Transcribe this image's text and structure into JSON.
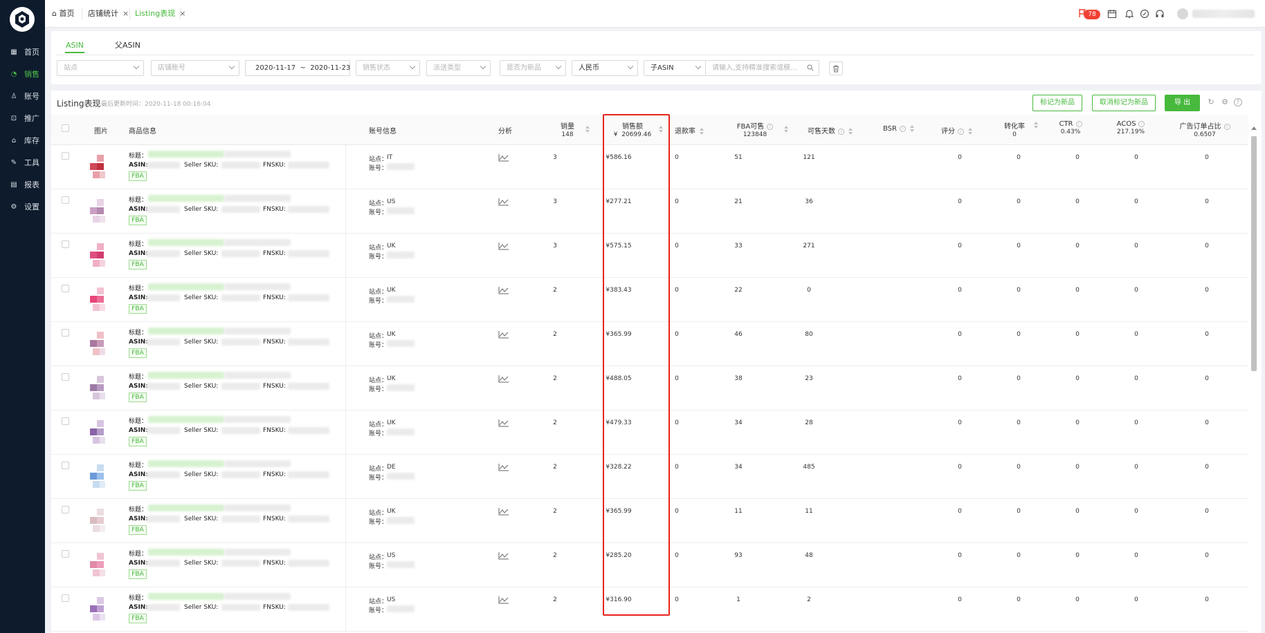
{
  "sidebar": {
    "items": [
      {
        "label": "首页",
        "icon": "grid-icon"
      },
      {
        "label": "销售",
        "icon": "chart-icon",
        "active": true
      },
      {
        "label": "账号",
        "icon": "user-icon"
      },
      {
        "label": "推广",
        "icon": "promotion-icon"
      },
      {
        "label": "库存",
        "icon": "warehouse-icon"
      },
      {
        "label": "工具",
        "icon": "tool-icon"
      },
      {
        "label": "报表",
        "icon": "table-icon"
      },
      {
        "label": "设置",
        "icon": "gear-icon"
      }
    ]
  },
  "topbar": {
    "tabs": [
      {
        "label": "首页"
      },
      {
        "label": "店铺统计"
      },
      {
        "label": "Listing表现",
        "active": true
      }
    ],
    "notification_count": "78"
  },
  "filters": {
    "subtabs": [
      "ASIN",
      "父ASIN"
    ],
    "site_placeholder": "站点",
    "account_placeholder": "店铺账号",
    "date_range": "2020-11-17  ~  2020-11-23",
    "sales_status_placeholder": "销售状态",
    "shipping_type_placeholder": "派送类型",
    "is_new_placeholder": "是否为新品",
    "currency": "人民币",
    "asin_type": "子ASIN",
    "search_placeholder": "请输入,支持精准搜索或模..."
  },
  "card": {
    "title": "Listing表现",
    "last_update": "最后更新时间：2020-11-18 00:16:04",
    "mark_new": "标记为新品",
    "unmark_new": "取消标记为新品",
    "export": "导 出"
  },
  "table": {
    "headers": {
      "image": "图片",
      "product": "商品信息",
      "account": "账号信息",
      "analysis": "分析",
      "sales_qty": "销量",
      "sales_qty_total": "148",
      "sales_amount": "销售额",
      "sales_amount_total": "¥  20699.46",
      "return_rate": "退款率",
      "fba_available": "FBA可售",
      "fba_available_total": "123848",
      "days_available": "可售天数",
      "bsr": "BSR",
      "rating": "评分",
      "conversion": "转化率",
      "conversion_total": "0",
      "ctr": "CTR",
      "ctr_total": "0.43%",
      "acos": "ACOS",
      "acos_total": "217.19%",
      "ad_order_ratio": "广告订单占比",
      "ad_order_ratio_total": "0.6507"
    },
    "labels": {
      "title": "标题：",
      "asin": "ASIN:",
      "seller_sku": "Seller SKU:",
      "fnsku": "FNSKU:",
      "fba": "FBA",
      "site": "站点：",
      "account": "账号："
    },
    "rows": [
      {
        "site": "IT",
        "qty": "3",
        "amount": "¥586.16",
        "refund": "0",
        "fba": "51",
        "days": "121",
        "rating": "0",
        "conv": "0",
        "ctr": "0",
        "acos": "0",
        "ad": "0",
        "swatch": [
          "#e8a0a8",
          "#d0485a",
          "#c0303f",
          "#f0c8cc"
        ]
      },
      {
        "site": "US",
        "qty": "3",
        "amount": "¥277.21",
        "refund": "0",
        "fba": "21",
        "days": "36",
        "rating": "0",
        "conv": "0",
        "ctr": "0",
        "acos": "0",
        "ad": "0",
        "swatch": [
          "#e9d3e6",
          "#c9a0c4",
          "#b58ab0",
          "#efe2ec"
        ]
      },
      {
        "site": "UK",
        "qty": "3",
        "amount": "¥575.15",
        "refund": "0",
        "fba": "33",
        "days": "271",
        "rating": "0",
        "conv": "0",
        "ctr": "0",
        "acos": "0",
        "ad": "0",
        "swatch": [
          "#f0b0c4",
          "#e04f80",
          "#d23c70",
          "#f6d4df"
        ]
      },
      {
        "site": "UK",
        "qty": "2",
        "amount": "¥383.43",
        "refund": "0",
        "fba": "22",
        "days": "0",
        "rating": "0",
        "conv": "0",
        "ctr": "0",
        "acos": "0",
        "ad": "0",
        "swatch": [
          "#f3c2d2",
          "#e8457a",
          "#ee6d97",
          "#f8dde6"
        ]
      },
      {
        "site": "UK",
        "qty": "2",
        "amount": "¥365.99",
        "refund": "0",
        "fba": "46",
        "days": "80",
        "rating": "0",
        "conv": "0",
        "ctr": "0",
        "acos": "0",
        "ad": "0",
        "swatch": [
          "#f0c0c8",
          "#a878a0",
          "#c69ab8",
          "#efdde6"
        ]
      },
      {
        "site": "UK",
        "qty": "2",
        "amount": "¥488.05",
        "refund": "0",
        "fba": "38",
        "days": "23",
        "rating": "0",
        "conv": "0",
        "ctr": "0",
        "acos": "0",
        "ad": "0",
        "swatch": [
          "#d8c6dc",
          "#9c7aa6",
          "#b89ac0",
          "#e8e0ec"
        ]
      },
      {
        "site": "UK",
        "qty": "2",
        "amount": "¥479.33",
        "refund": "0",
        "fba": "34",
        "days": "28",
        "rating": "0",
        "conv": "0",
        "ctr": "0",
        "acos": "0",
        "ad": "0",
        "swatch": [
          "#d6c4e0",
          "#8a64a8",
          "#b49cc8",
          "#e8e0f0"
        ]
      },
      {
        "site": "DE",
        "qty": "2",
        "amount": "¥328.22",
        "refund": "0",
        "fba": "34",
        "days": "485",
        "rating": "0",
        "conv": "0",
        "ctr": "0",
        "acos": "0",
        "ad": "0",
        "swatch": [
          "#c8dcf0",
          "#6a9ad8",
          "#9cc0ec",
          "#e2ecf8"
        ]
      },
      {
        "site": "UK",
        "qty": "2",
        "amount": "¥365.99",
        "refund": "0",
        "fba": "11",
        "days": "11",
        "rating": "0",
        "conv": "0",
        "ctr": "0",
        "acos": "0",
        "ad": "0",
        "swatch": [
          "#ecdde0",
          "#d8bcc0",
          "#e6cdd2",
          "#f4ecee"
        ]
      },
      {
        "site": "US",
        "qty": "2",
        "amount": "¥285.20",
        "refund": "0",
        "fba": "93",
        "days": "48",
        "rating": "0",
        "conv": "0",
        "ctr": "0",
        "acos": "0",
        "ad": "0",
        "swatch": [
          "#f0c4d4",
          "#e08aa8",
          "#ec9cb8",
          "#f6e0e8"
        ]
      },
      {
        "site": "US",
        "qty": "2",
        "amount": "¥316.90",
        "refund": "0",
        "fba": "1",
        "days": "2",
        "rating": "0",
        "conv": "0",
        "ctr": "0",
        "acos": "0",
        "ad": "0",
        "swatch": [
          "#dcc8e6",
          "#9a70b8",
          "#c0a0d4",
          "#ece2f2"
        ]
      }
    ]
  },
  "colors": {
    "accent": "#47b93d",
    "sidebar_bg": "#0e1b2c",
    "highlight": "#e8231d",
    "badge": "#f04134"
  }
}
